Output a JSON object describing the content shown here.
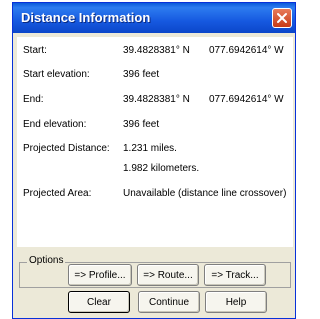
{
  "window": {
    "title": "Distance Information"
  },
  "info": {
    "start_label": "Start:",
    "start_lat": "39.4828381° N",
    "start_lon": "077.6942614° W",
    "start_elev_label": "Start elevation:",
    "start_elev": "396 feet",
    "end_label": "End:",
    "end_lat": "39.4828381° N",
    "end_lon": "077.6942614° W",
    "end_elev_label": "End elevation:",
    "end_elev": "396 feet",
    "proj_dist_label": "Projected Distance:",
    "proj_dist_miles": "1.231 miles.",
    "proj_dist_km": "1.982 kilometers.",
    "proj_area_label": "Projected Area:",
    "proj_area": "Unavailable (distance line crossover)"
  },
  "options": {
    "legend": "Options",
    "profile": "=> Profile...",
    "route": "=> Route...",
    "track": "=> Track..."
  },
  "buttons": {
    "clear": "Clear",
    "continue": "Continue",
    "help": "Help"
  },
  "icons": {
    "close": "close-icon"
  },
  "colors": {
    "titlebar": "#0b46c9",
    "close_button": "#c73b17",
    "dialog_background": "#ece9d8"
  }
}
